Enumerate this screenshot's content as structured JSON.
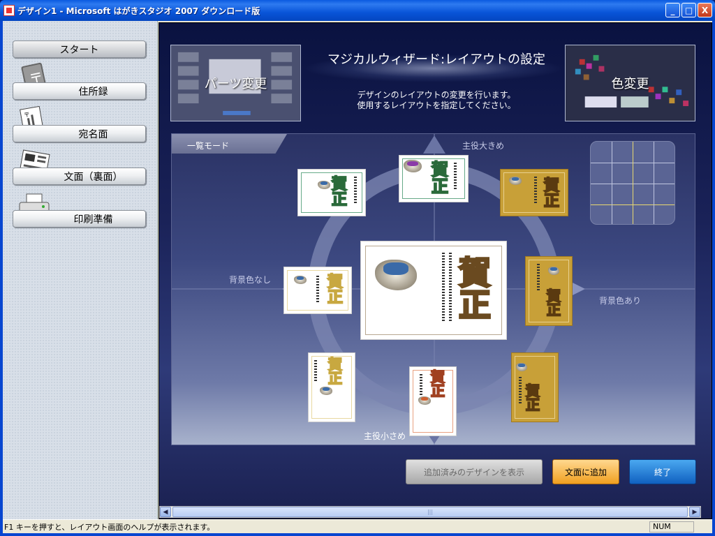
{
  "window": {
    "title": "デザイン1 - Microsoft はがきスタジオ 2007 ダウンロード版",
    "minimize": "_",
    "maximize": "□",
    "close": "X"
  },
  "sidebar": {
    "start": "スタート",
    "items": [
      {
        "label": "住所録",
        "icon": "address-book-icon"
      },
      {
        "label": "宛名面",
        "icon": "address-side-icon"
      },
      {
        "label": "文面（裏面）",
        "icon": "message-side-icon"
      },
      {
        "label": "印刷準備",
        "icon": "printer-icon"
      }
    ]
  },
  "wizard": {
    "title": "マジカルウィザード:レイアウトの設定",
    "desc_line1": "デザインのレイアウトの変更を行います。",
    "desc_line2": "使用するレイアウトを指定してください。",
    "left_panel": "パーツ変更",
    "right_panel": "色変更"
  },
  "stage": {
    "mode_tab": "一覧モード",
    "top_label": "主役大きめ",
    "bottom_label": "主役小さめ",
    "left_label": "背景色なし",
    "right_label": "背景色あり",
    "card_text": "賀正",
    "center_message": "旧年中は大変お世話になりました 今年もよろしくお願いいたします。"
  },
  "buttons": {
    "show_added": "追加済みのデザインを表示",
    "add_to_message": "文面に追加",
    "exit": "終了"
  },
  "status": {
    "help": "F1 キーを押すと、レイアウト画面のヘルプが表示されます。",
    "num": "NUM"
  }
}
